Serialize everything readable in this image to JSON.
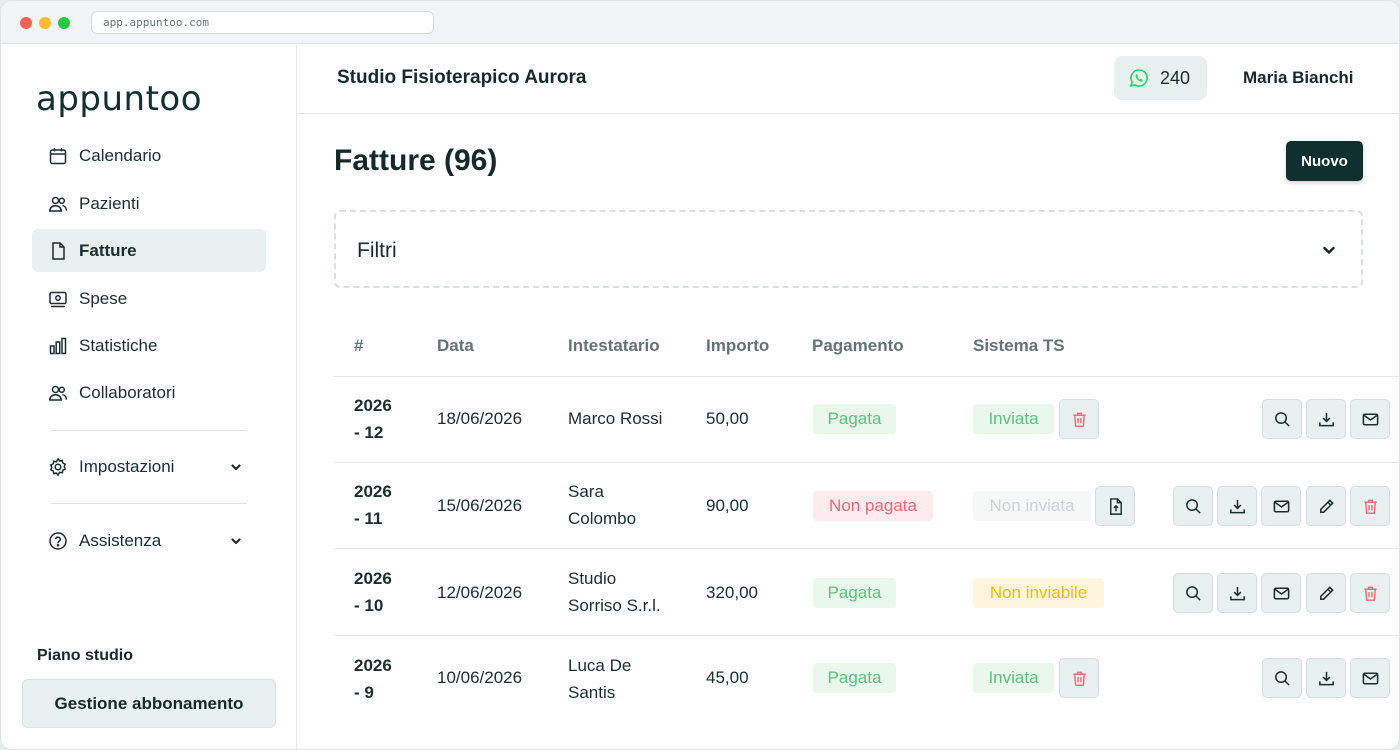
{
  "browser": {
    "url": "app.appuntoo.com"
  },
  "sidebar": {
    "logo": "appuntoo",
    "items": [
      {
        "label": "Calendario",
        "icon": "calendar-icon"
      },
      {
        "label": "Pazienti",
        "icon": "users-icon"
      },
      {
        "label": "Fatture",
        "icon": "file-icon",
        "active": true
      },
      {
        "label": "Spese",
        "icon": "receipt-icon"
      },
      {
        "label": "Statistiche",
        "icon": "bar-chart-icon"
      },
      {
        "label": "Collaboratori",
        "icon": "users-icon"
      },
      {
        "label": "Impostazioni",
        "icon": "gear-icon"
      },
      {
        "label": "Assistenza",
        "icon": "help-icon"
      }
    ],
    "plan_title": "Piano studio",
    "plan_button": "Gestione abbonamento"
  },
  "header": {
    "studio_name": "Studio Fisioterapico Aurora",
    "whatsapp_count": "240",
    "user_name": "Maria Bianchi"
  },
  "main": {
    "title": "Fatture (96)",
    "new_button": "Nuovo",
    "filters_label": "Filtri",
    "columns": [
      "#",
      "Data",
      "Intestatario",
      "Importo",
      "Pagamento",
      "Sistema TS"
    ],
    "rows": [
      {
        "num1": "2026",
        "num2": "- 12",
        "date": "18/06/2026",
        "holder1": "Marco Rossi",
        "holder2": "",
        "amount": "50,00",
        "payment": "Pagata",
        "ts": "Inviata"
      },
      {
        "num1": "2026",
        "num2": "- 11",
        "date": "15/06/2026",
        "holder1": "Sara",
        "holder2": "Colombo",
        "amount": "90,00",
        "payment": "Non pagata",
        "ts": "Non inviata"
      },
      {
        "num1": "2026",
        "num2": "- 10",
        "date": "12/06/2026",
        "holder1": "Studio",
        "holder2": "Sorriso S.r.l.",
        "amount": "320,00",
        "payment": "Pagata",
        "ts": "Non inviabile"
      },
      {
        "num1": "2026",
        "num2": "- 9",
        "date": "10/06/2026",
        "holder1": "Luca De",
        "holder2": "Santis",
        "amount": "45,00",
        "payment": "Pagata",
        "ts": "Inviata"
      }
    ]
  },
  "colors": {
    "brand_dark": "#10302f",
    "active_bg": "#e9f0f0",
    "paid_green": "#5bc47a",
    "unpaid_red": "#ea6a78",
    "pending_yellow": "#e9bd10",
    "whatsapp_green": "#25d366"
  }
}
